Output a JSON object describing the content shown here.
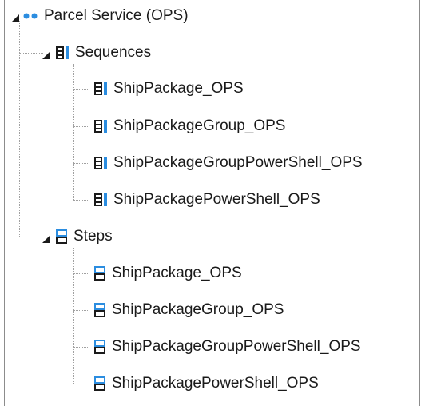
{
  "root": {
    "label": "Parcel Service (OPS)",
    "icon": "service-dots-icon",
    "expanded": true
  },
  "sequences": {
    "label": "Sequences",
    "icon": "sequence-icon",
    "expanded": true,
    "items": [
      {
        "label": "ShipPackage_OPS"
      },
      {
        "label": "ShipPackageGroup_OPS"
      },
      {
        "label": "ShipPackageGroupPowerShell_OPS"
      },
      {
        "label": "ShipPackagePowerShell_OPS"
      }
    ]
  },
  "steps": {
    "label": "Steps",
    "icon": "step-icon",
    "expanded": true,
    "items": [
      {
        "label": "ShipPackage_OPS"
      },
      {
        "label": "ShipPackageGroup_OPS"
      },
      {
        "label": "ShipPackageGroupPowerShell_OPS"
      },
      {
        "label": "ShipPackagePowerShell_OPS"
      }
    ]
  },
  "colors": {
    "accent": "#2b8de0",
    "dark": "#1a1a1a",
    "connector": "#a0a0a0"
  }
}
